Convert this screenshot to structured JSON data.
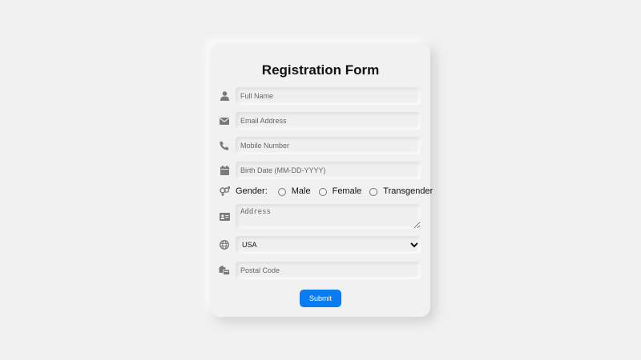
{
  "form": {
    "title": "Registration Form",
    "full_name": {
      "placeholder": "Full Name",
      "icon": "user-icon"
    },
    "email": {
      "placeholder": "Email Address",
      "icon": "envelope-icon"
    },
    "mobile": {
      "placeholder": "Mobile Number",
      "icon": "phone-icon"
    },
    "birth_date": {
      "placeholder": "Birth Date (MM-DD-YYYY)",
      "icon": "calendar-icon"
    },
    "gender": {
      "label": "Gender:",
      "icon": "gender-icon",
      "options": [
        "Male",
        "Female",
        "Transgender"
      ]
    },
    "address": {
      "placeholder": "Address",
      "icon": "address-card-icon"
    },
    "country": {
      "selected": "USA",
      "icon": "globe-icon"
    },
    "postal_code": {
      "placeholder": "Postal Code",
      "icon": "mailbox-icon"
    },
    "submit_label": "Submit"
  },
  "colors": {
    "background": "#f0f0f0",
    "icon": "#7a7a7a",
    "accent": "#0a7cf0"
  }
}
